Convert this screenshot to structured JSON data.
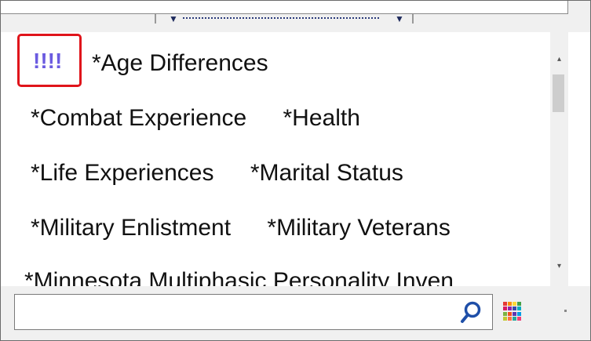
{
  "tags": {
    "marker": "!!!!",
    "rows": [
      [
        "*Age Differences"
      ],
      [
        "*Combat Experience",
        "*Health"
      ],
      [
        "*Life Experiences",
        "*Marital Status"
      ],
      [
        "*Military Enlistment",
        "*Military Veterans"
      ],
      [
        "*Minnesota Multiphasic Personality Inven"
      ]
    ]
  },
  "search": {
    "value": "",
    "placeholder": ""
  },
  "icons": {
    "search": "search-icon",
    "grid": "color-grid-icon"
  },
  "colors": {
    "highlight": "#e0141b",
    "marker": "#6b5be0"
  }
}
